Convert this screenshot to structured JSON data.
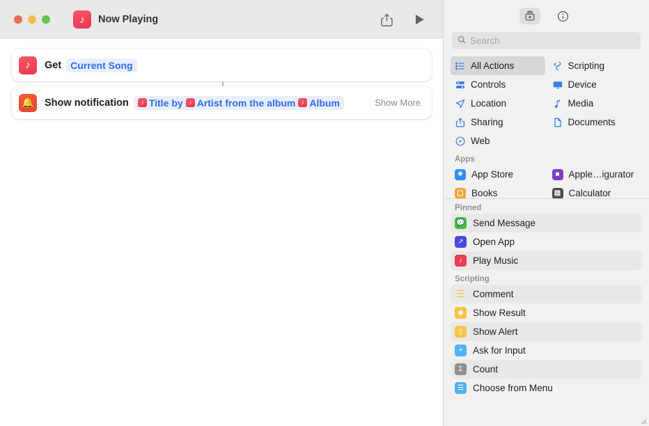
{
  "window": {
    "title": "Now Playing",
    "app_icon": "music-note-icon",
    "traffic_lights": [
      "close",
      "minimize",
      "zoom"
    ],
    "toolbar": [
      {
        "name": "share-button",
        "icon": "share-icon"
      },
      {
        "name": "play-button",
        "icon": "play-icon"
      }
    ]
  },
  "workflow": {
    "actions": [
      {
        "icon": "music-note-icon",
        "label": "Get",
        "parameter": "Current Song"
      },
      {
        "icon": "bell-icon",
        "label": "Show notification",
        "tokens": [
          {
            "type": "variable",
            "chip": "music-note-icon",
            "text": "Title"
          },
          {
            "type": "text",
            "text": "by"
          },
          {
            "type": "variable",
            "chip": "music-note-icon",
            "text": "Artist"
          },
          {
            "type": "text",
            "text": "from the album"
          },
          {
            "type": "variable",
            "chip": "music-note-icon",
            "text": "Album"
          }
        ],
        "show_more": "Show More"
      }
    ]
  },
  "sidebar": {
    "toolbar": [
      {
        "name": "action-library-button",
        "icon": "library-icon",
        "selected": true
      },
      {
        "name": "info-button",
        "icon": "info-icon",
        "selected": false
      }
    ],
    "search": {
      "placeholder": "Search",
      "value": "",
      "icon": "search-icon"
    },
    "categories": [
      {
        "label": "All Actions",
        "icon": "list-icon",
        "selected": true
      },
      {
        "label": "Scripting",
        "icon": "scripting-icon",
        "selected": false
      },
      {
        "label": "Controls",
        "icon": "controls-icon",
        "selected": false
      },
      {
        "label": "Device",
        "icon": "display-icon",
        "selected": false
      },
      {
        "label": "Location",
        "icon": "paper-plane-icon",
        "selected": false
      },
      {
        "label": "Media",
        "icon": "music-note-icon",
        "selected": false
      },
      {
        "label": "Sharing",
        "icon": "share-icon",
        "selected": false
      },
      {
        "label": "Documents",
        "icon": "document-icon",
        "selected": false
      },
      {
        "label": "Web",
        "icon": "compass-icon",
        "selected": false
      }
    ],
    "apps_section": {
      "header": "Apps",
      "items": [
        {
          "label": "App Store",
          "icon": "app-store-icon",
          "color": "#2f8ef5",
          "glyph": "A"
        },
        {
          "label": "Apple…igurator",
          "icon": "apple-configurator-icon",
          "color": "#7b3fc4",
          "glyph": "■"
        },
        {
          "label": "Books",
          "icon": "books-icon",
          "color": "#f5a33c",
          "glyph": "▫"
        },
        {
          "label": "Calculator",
          "icon": "calculator-icon",
          "color": "#4a4a4c",
          "glyph": "▤"
        }
      ]
    },
    "pinned_section": {
      "header": "Pinned",
      "items": [
        {
          "label": "Send Message",
          "icon": "message-icon",
          "color": "#3ec04a",
          "glyph": "●"
        },
        {
          "label": "Open App",
          "icon": "open-app-icon",
          "color": "#4b49dd",
          "glyph": "↗"
        },
        {
          "label": "Play Music",
          "icon": "music-note-icon",
          "color": "#ea3b53",
          "glyph": "♫"
        }
      ]
    },
    "scripting_section": {
      "header": "Scripting",
      "items": [
        {
          "label": "Comment",
          "icon": "comment-icon",
          "color": "#f6c445",
          "glyph": "≡"
        },
        {
          "label": "Show Result",
          "icon": "show-result-icon",
          "color": "#f6c445",
          "glyph": "⌘"
        },
        {
          "label": "Show Alert",
          "icon": "show-alert-icon",
          "color": "#f6c445",
          "glyph": "▭"
        },
        {
          "label": "Ask for Input",
          "icon": "ask-for-input-icon",
          "color": "#4fb3f5",
          "glyph": "✉"
        },
        {
          "label": "Count",
          "icon": "count-icon",
          "color": "#8e8e91",
          "glyph": "Σ"
        },
        {
          "label": "Choose from Menu",
          "icon": "choose-from-menu-icon",
          "color": "#4fb3f5",
          "glyph": "☰"
        }
      ]
    }
  },
  "colors": {
    "accent_blue": "#2e6bf0",
    "category_icon_blue": "#3b7dea",
    "sidebar_bg": "#f1f1ef",
    "titlebar_bg": "#e9e9e7"
  }
}
